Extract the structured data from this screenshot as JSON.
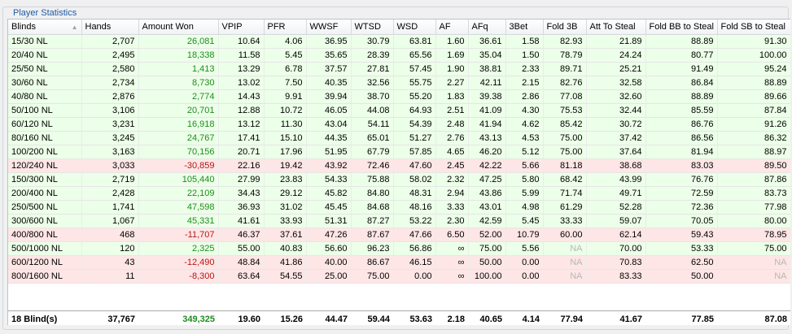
{
  "panel": {
    "title": "Player Statistics"
  },
  "table": {
    "columns": [
      "Blinds",
      "Hands",
      "Amount Won",
      "VPIP",
      "PFR",
      "WWSF",
      "WTSD",
      "WSD",
      "AF",
      "AFq",
      "3Bet",
      "Fold 3B",
      "Att To Steal",
      "Fold BB to Steal",
      "Fold SB to Steal"
    ],
    "rows": [
      [
        "15/30 NL",
        "2,707",
        "26,081",
        "10.64",
        "4.06",
        "36.95",
        "30.79",
        "63.81",
        "1.60",
        "36.61",
        "1.58",
        "82.93",
        "21.89",
        "88.89",
        "91.30"
      ],
      [
        "20/40 NL",
        "2,495",
        "18,338",
        "11.58",
        "5.45",
        "35.65",
        "28.39",
        "65.56",
        "1.69",
        "35.04",
        "1.50",
        "78.79",
        "24.24",
        "80.77",
        "100.00"
      ],
      [
        "25/50 NL",
        "2,580",
        "1,413",
        "13.29",
        "6.78",
        "37.57",
        "27.81",
        "57.45",
        "1.90",
        "38.81",
        "2.33",
        "89.71",
        "25.21",
        "91.49",
        "95.24"
      ],
      [
        "30/60 NL",
        "2,734",
        "8,730",
        "13.02",
        "7.50",
        "40.35",
        "32.56",
        "55.75",
        "2.27",
        "42.11",
        "2.15",
        "82.76",
        "32.58",
        "86.84",
        "88.89"
      ],
      [
        "40/80 NL",
        "2,876",
        "2,774",
        "14.43",
        "9.91",
        "39.94",
        "38.70",
        "55.20",
        "1.83",
        "39.38",
        "2.86",
        "77.08",
        "32.60",
        "88.89",
        "89.66"
      ],
      [
        "50/100 NL",
        "3,106",
        "20,701",
        "12.88",
        "10.72",
        "46.05",
        "44.08",
        "64.93",
        "2.51",
        "41.09",
        "4.30",
        "75.53",
        "32.44",
        "85.59",
        "87.84"
      ],
      [
        "60/120 NL",
        "3,231",
        "16,918",
        "13.12",
        "11.30",
        "43.04",
        "54.11",
        "54.39",
        "2.48",
        "41.94",
        "4.62",
        "85.42",
        "30.72",
        "86.76",
        "91.26"
      ],
      [
        "80/160 NL",
        "3,245",
        "24,767",
        "17.41",
        "15.10",
        "44.35",
        "65.01",
        "51.27",
        "2.76",
        "43.13",
        "4.53",
        "75.00",
        "37.42",
        "86.56",
        "86.32"
      ],
      [
        "100/200 NL",
        "3,163",
        "70,156",
        "20.71",
        "17.96",
        "51.95",
        "67.79",
        "57.85",
        "4.65",
        "46.20",
        "5.12",
        "75.00",
        "37.64",
        "81.94",
        "88.97"
      ],
      [
        "120/240 NL",
        "3,033",
        "-30,859",
        "22.16",
        "19.42",
        "43.92",
        "72.46",
        "47.60",
        "2.45",
        "42.22",
        "5.66",
        "81.18",
        "38.68",
        "83.03",
        "89.50"
      ],
      [
        "150/300 NL",
        "2,719",
        "105,440",
        "27.99",
        "23.83",
        "54.33",
        "75.88",
        "58.02",
        "2.32",
        "47.25",
        "5.80",
        "68.42",
        "43.99",
        "76.76",
        "87.86"
      ],
      [
        "200/400 NL",
        "2,428",
        "22,109",
        "34.43",
        "29.12",
        "45.82",
        "84.80",
        "48.31",
        "2.94",
        "43.86",
        "5.99",
        "71.74",
        "49.71",
        "72.59",
        "83.73"
      ],
      [
        "250/500 NL",
        "1,741",
        "47,598",
        "36.93",
        "31.02",
        "45.45",
        "84.68",
        "48.16",
        "3.33",
        "43.01",
        "4.98",
        "61.29",
        "52.28",
        "72.36",
        "77.98"
      ],
      [
        "300/600 NL",
        "1,067",
        "45,331",
        "41.61",
        "33.93",
        "51.31",
        "87.27",
        "53.22",
        "2.30",
        "42.59",
        "5.45",
        "33.33",
        "59.07",
        "70.05",
        "80.00"
      ],
      [
        "400/800 NL",
        "468",
        "-11,707",
        "46.37",
        "37.61",
        "47.26",
        "87.67",
        "47.66",
        "6.50",
        "52.00",
        "10.79",
        "60.00",
        "62.14",
        "59.43",
        "78.95"
      ],
      [
        "500/1000 NL",
        "120",
        "2,325",
        "55.00",
        "40.83",
        "56.60",
        "96.23",
        "56.86",
        "∞",
        "75.00",
        "5.56",
        "NA",
        "70.00",
        "53.33",
        "75.00"
      ],
      [
        "600/1200 NL",
        "43",
        "-12,490",
        "48.84",
        "41.86",
        "40.00",
        "86.67",
        "46.15",
        "∞",
        "50.00",
        "0.00",
        "NA",
        "70.83",
        "62.50",
        "NA"
      ],
      [
        "800/1600 NL",
        "11",
        "-8,300",
        "63.64",
        "54.55",
        "25.00",
        "75.00",
        "0.00",
        "∞",
        "100.00",
        "0.00",
        "NA",
        "83.33",
        "50.00",
        "NA"
      ]
    ],
    "totals": [
      "18 Blind(s)",
      "37,767",
      "349,325",
      "19.60",
      "15.26",
      "44.47",
      "59.44",
      "53.63",
      "2.18",
      "40.65",
      "4.14",
      "77.94",
      "41.67",
      "77.85",
      "87.08"
    ]
  },
  "colors": {
    "positive_row": "#ecffe8",
    "negative_row": "#ffe6e6",
    "positive_amount": "#1f8c1f",
    "negative_amount": "#b81414",
    "title": "#1f5aa6"
  },
  "icons": {
    "sort_indicator": "sort-ascending-icon"
  }
}
